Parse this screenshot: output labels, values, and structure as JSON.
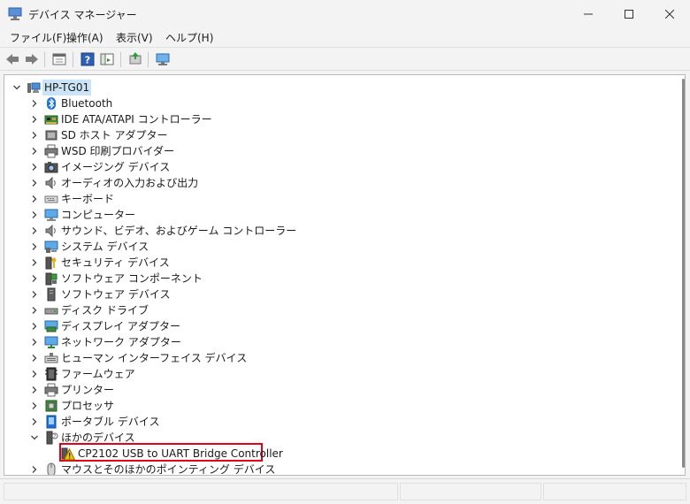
{
  "window": {
    "title": "デバイス マネージャー",
    "icon": "device-manager-icon"
  },
  "menu": [
    {
      "label": "ファイル(F)"
    },
    {
      "label": "操作(A)"
    },
    {
      "label": "表示(V)"
    },
    {
      "label": "ヘルプ(H)"
    }
  ],
  "toolbar": {
    "icons": [
      "back-arrow-icon",
      "forward-arrow-icon",
      "properties-icon",
      "help-icon",
      "console-tree-icon",
      "update-driver-icon",
      "monitor-scan-icon"
    ]
  },
  "tree": {
    "root": {
      "label": "HP-TG01",
      "icon": "computer-icon",
      "expanded": true
    },
    "items": [
      {
        "label": "Bluetooth",
        "icon": "bluetooth-icon",
        "expanded": false
      },
      {
        "label": "IDE ATA/ATAPI コントローラー",
        "icon": "ide-controller-icon",
        "expanded": false
      },
      {
        "label": "SD ホスト アダプター",
        "icon": "sd-host-icon",
        "expanded": false
      },
      {
        "label": "WSD 印刷プロバイダー",
        "icon": "printer-icon",
        "expanded": false
      },
      {
        "label": "イメージング デバイス",
        "icon": "camera-icon",
        "expanded": false
      },
      {
        "label": "オーディオの入力および出力",
        "icon": "speaker-icon",
        "expanded": false
      },
      {
        "label": "キーボード",
        "icon": "keyboard-icon",
        "expanded": false
      },
      {
        "label": "コンピューター",
        "icon": "monitor-icon",
        "expanded": false
      },
      {
        "label": "サウンド、ビデオ、およびゲーム コントローラー",
        "icon": "speaker-icon",
        "expanded": false
      },
      {
        "label": "システム デバイス",
        "icon": "system-device-icon",
        "expanded": false
      },
      {
        "label": "セキュリティ デバイス",
        "icon": "security-key-icon",
        "expanded": false
      },
      {
        "label": "ソフトウェア コンポーネント",
        "icon": "software-component-icon",
        "expanded": false
      },
      {
        "label": "ソフトウェア デバイス",
        "icon": "software-device-icon",
        "expanded": false
      },
      {
        "label": "ディスク ドライブ",
        "icon": "disk-drive-icon",
        "expanded": false
      },
      {
        "label": "ディスプレイ アダプター",
        "icon": "display-adapter-icon",
        "expanded": false
      },
      {
        "label": "ネットワーク アダプター",
        "icon": "network-adapter-icon",
        "expanded": false
      },
      {
        "label": "ヒューマン インターフェイス デバイス",
        "icon": "hid-icon",
        "expanded": false
      },
      {
        "label": "ファームウェア",
        "icon": "firmware-icon",
        "expanded": false
      },
      {
        "label": "プリンター",
        "icon": "printer-icon",
        "expanded": false
      },
      {
        "label": "プロセッサ",
        "icon": "processor-icon",
        "expanded": false
      },
      {
        "label": "ポータブル デバイス",
        "icon": "portable-device-icon",
        "expanded": false
      },
      {
        "label": "ほかのデバイス",
        "icon": "unknown-device-icon",
        "expanded": true,
        "children": [
          {
            "label": "CP2102 USB to UART Bridge Controller",
            "icon": "warning-device-icon",
            "highlighted": true
          }
        ]
      },
      {
        "label": "マウスとそのほかのポインティング デバイス",
        "icon": "mouse-icon",
        "expanded": false
      }
    ]
  },
  "colors": {
    "selection": "#cce4f7",
    "highlight_border": "#e3001b",
    "warning": "#f2c200"
  }
}
